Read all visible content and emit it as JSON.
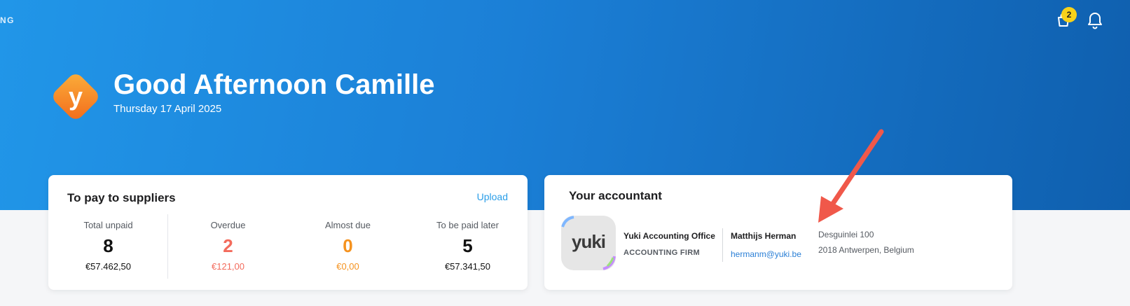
{
  "nav": {
    "fragment": "NG"
  },
  "header": {
    "cart_badge": "2",
    "greeting": "Good Afternoon Camille",
    "date": "Thursday 17 April 2025",
    "logo_letter": "y"
  },
  "suppliers": {
    "title": "To pay to suppliers",
    "upload_label": "Upload",
    "stats": [
      {
        "label": "Total unpaid",
        "count": "8",
        "amount": "€57.462,50"
      },
      {
        "label": "Overdue",
        "count": "2",
        "amount": "€121,00"
      },
      {
        "label": "Almost due",
        "count": "0",
        "amount": "€0,00"
      },
      {
        "label": "To be paid later",
        "count": "5",
        "amount": "€57.341,50"
      }
    ]
  },
  "accountant": {
    "title": "Your accountant",
    "logo_text": "yuki",
    "firm_name": "Yuki Accounting Office",
    "firm_type": "ACCOUNTING FIRM",
    "person_name": "Matthijs Herman",
    "email": "hermanm@yuki.be",
    "address_line1": "Desguinlei 100",
    "address_line2": "2018 Antwerpen, Belgium"
  },
  "colors": {
    "hero_blue": "#1b7fd6",
    "accent_link": "#2a9ee8",
    "overdue_red": "#f36b5c",
    "almost_due_orange": "#f5921e",
    "badge_yellow": "#f7d21a",
    "annotation_arrow": "#f0584a"
  },
  "icons": [
    "cart-icon",
    "bell-icon",
    "yuki-logo-icon",
    "annotation-arrow"
  ]
}
